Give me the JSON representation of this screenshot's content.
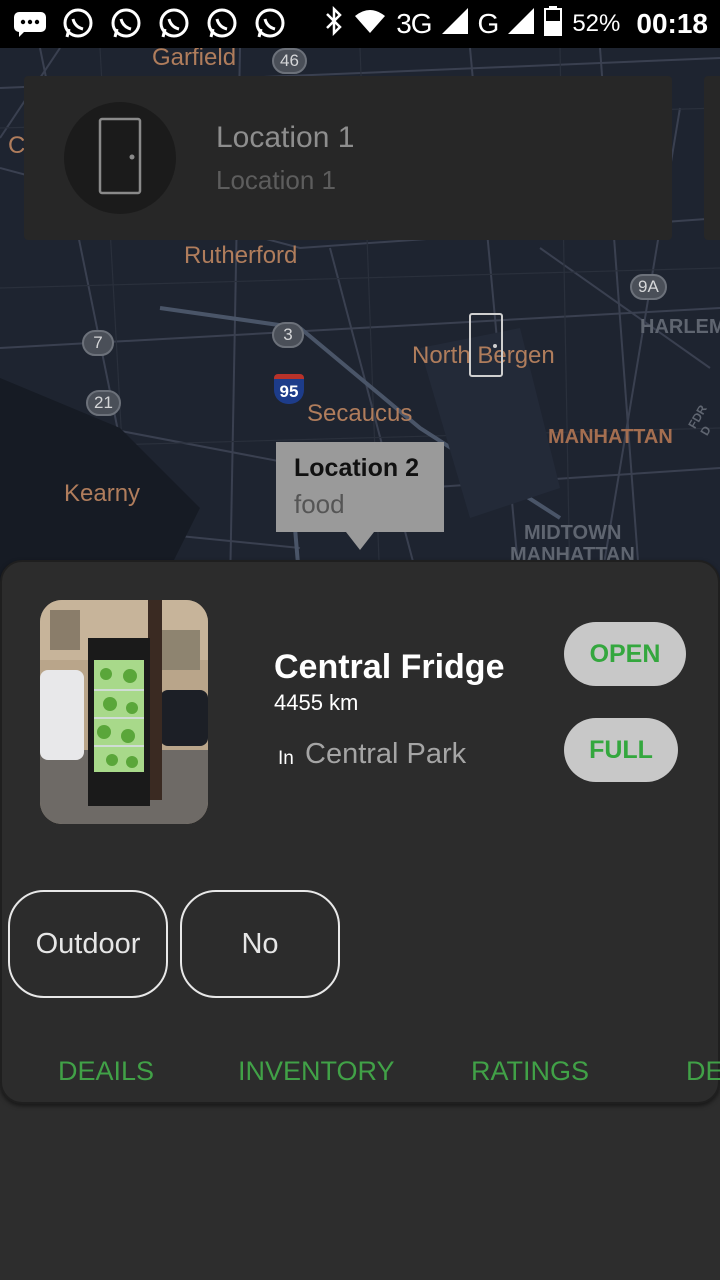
{
  "status_bar": {
    "icons": [
      "message-icon",
      "whatsapp-icon",
      "whatsapp-icon",
      "whatsapp-icon",
      "whatsapp-icon",
      "whatsapp-icon"
    ],
    "network": "3G",
    "network2": "G",
    "battery": "52%",
    "time": "00:18"
  },
  "map": {
    "places": {
      "garfield": "Garfield",
      "rutherford": "Rutherford",
      "north_bergen": "North Bergen",
      "secaucus": "Secaucus",
      "kearny": "Kearny",
      "manhattan": "MANHATTAN",
      "harlem": "HARLEM",
      "midtown": "MIDTOWN",
      "midtown2": "MANHATTAN",
      "fdr": "FDR D",
      "c": "C"
    },
    "shields": {
      "r46": "46",
      "r9a": "9A",
      "r3": "3",
      "r7": "7",
      "r21": "21",
      "i95": "95"
    },
    "location_card": {
      "title": "Location 1",
      "subtitle": "Location 1"
    },
    "info_window": {
      "title": "Location 2",
      "subtitle": "food"
    }
  },
  "sheet": {
    "name": "Central Fridge",
    "distance": "4455 km",
    "in_label": "In",
    "area": "Central Park",
    "status_open": "OPEN",
    "status_full": "FULL",
    "chips": [
      "Outdoor",
      "No"
    ],
    "tabs": [
      "DEAILS",
      "INVENTORY",
      "RATINGS",
      "DE"
    ]
  },
  "colors": {
    "accent_green": "#41a147",
    "pill_bg": "#c8c8c8",
    "sheet_bg": "#2c2c2c"
  }
}
